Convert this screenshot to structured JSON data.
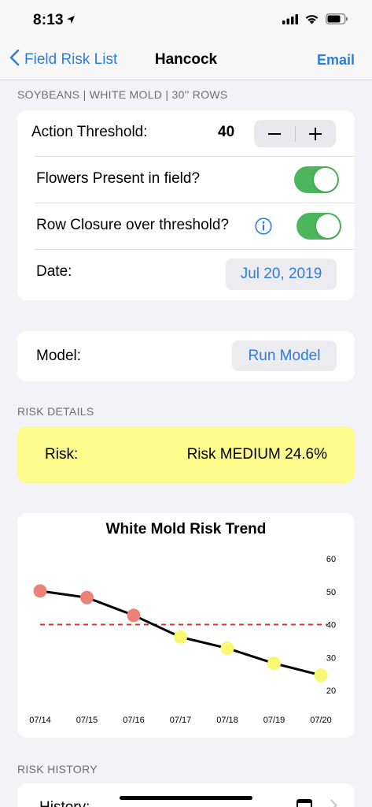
{
  "status": {
    "time": "8:13"
  },
  "nav": {
    "back_label": "Field Risk List",
    "title": "Hancock",
    "action_label": "Email"
  },
  "field_section": {
    "header": "SOYBEANS | WHITE MOLD | 30'' ROWS",
    "action_threshold": {
      "label": "Action Threshold:",
      "value": "40"
    },
    "flowers": {
      "label": "Flowers Present in field?",
      "on": true
    },
    "row_closure": {
      "label": "Row Closure over threshold?",
      "on": true
    },
    "date": {
      "label": "Date:",
      "value": "Jul 20, 2019"
    }
  },
  "model": {
    "label": "Model:",
    "button": "Run Model"
  },
  "risk_details": {
    "header": "RISK DETAILS",
    "label": "Risk:",
    "value": "Risk MEDIUM 24.6%",
    "color": "#fdfb8b"
  },
  "chart_data": {
    "type": "line",
    "title": "White Mold Risk Trend",
    "categories": [
      "07/14",
      "07/15",
      "07/16",
      "07/17",
      "07/18",
      "07/19",
      "07/20"
    ],
    "values": [
      50.2,
      48.2,
      42.8,
      36.2,
      32.8,
      28.2,
      24.6
    ],
    "point_colors": [
      "#ec8178",
      "#ec8178",
      "#ec8178",
      "#f9f871",
      "#f9f871",
      "#f9f871",
      "#f9f871"
    ],
    "threshold": 40,
    "ylim": [
      20,
      60
    ],
    "yticks": [
      "60",
      "50",
      "40",
      "30",
      "20"
    ],
    "ytick_values": [
      60,
      50,
      40,
      30,
      20
    ],
    "line_color": "#000000",
    "threshold_color": "#d9362b"
  },
  "risk_history": {
    "header": "RISK HISTORY",
    "label": "History:"
  }
}
